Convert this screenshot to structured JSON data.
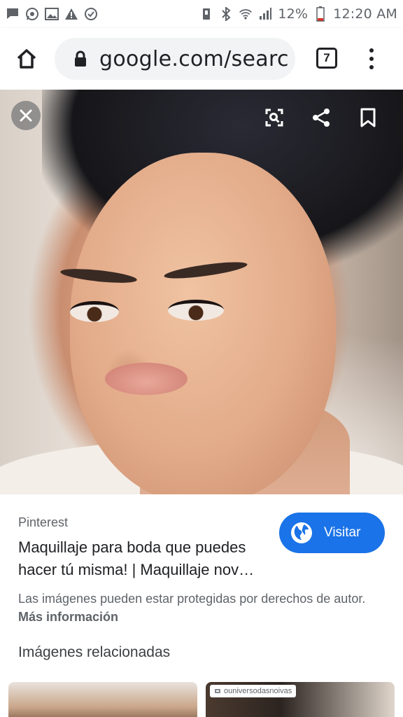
{
  "status_bar": {
    "battery_percent": "12%",
    "time": "12:20 AM",
    "left_icons": [
      "chat-icon",
      "whatsapp-icon",
      "image-icon",
      "warning-icon",
      "check-circle-icon"
    ],
    "right_icons": [
      "vibrate-icon",
      "bluetooth-icon",
      "wifi-icon",
      "signal-icon",
      "battery-icon"
    ]
  },
  "browser": {
    "url": "google.com/searc",
    "tab_count": "7"
  },
  "image_viewer": {
    "actions": [
      "close-icon",
      "lens-icon",
      "share-icon",
      "bookmark-icon"
    ]
  },
  "result": {
    "source": "Pinterest",
    "title_line1": "Maquillaje para boda que puedes",
    "title_line2": "hacer tú misma! | Maquillaje nov…",
    "visit_label": "Visitar",
    "notice_text": "Las imágenes pueden estar protegidas por derechos de autor.",
    "notice_link": "Más información"
  },
  "related": {
    "heading": "Imágenes relacionadas",
    "thumbs": [
      {
        "caption": ""
      },
      {
        "caption": "ouniversodasnoivas"
      }
    ]
  },
  "colors": {
    "accent": "#1a73e8",
    "pill_bg": "#f1f3f4",
    "battery_low": "#d93025"
  }
}
